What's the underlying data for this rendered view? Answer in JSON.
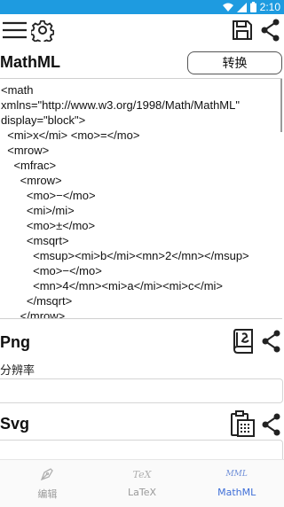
{
  "status_bar": {
    "time": "2:10",
    "icons": [
      "wifi-icon",
      "signal-icon",
      "battery-icon"
    ],
    "background": "#1e9be0"
  },
  "toolbar": {
    "icons": [
      "menu-icon",
      "settings-icon",
      "save-icon",
      "share-icon"
    ]
  },
  "mathml": {
    "title": "MathML",
    "convert_label": "转换",
    "code_lines": [
      "<math",
      "xmlns=\"http://www.w3.org/1998/Math/MathML\"",
      "display=\"block\">",
      "  <mi>x</mi> <mo>=</mo>",
      "  <mrow>",
      "    <mfrac>",
      "      <mrow>",
      "        <mo>−</mo>",
      "        <mi>/mi>",
      "        <mo>±</mo>",
      "        <msqrt>",
      "          <msup><mi>b</mi><mn>2</mn></msup>",
      "          <mo>−</mo>",
      "          <mn>4</mn><mi>a</mi><mi>c</mi>",
      "        </msqrt>",
      "      </mrow>"
    ]
  },
  "png": {
    "title": "Png",
    "resolution_label": "分辨率",
    "resolution_value": ""
  },
  "svg": {
    "title": "Svg"
  },
  "bottom_nav": {
    "items": [
      {
        "label": "编辑",
        "icon": "pen-nib-icon",
        "active": false
      },
      {
        "label": "LaTeX",
        "icon": "tex-icon",
        "glyph": "TeX",
        "active": false
      },
      {
        "label": "MathML",
        "icon": "mml-icon",
        "glyph": "MML",
        "active": true
      }
    ],
    "accent": "#3f6fd8"
  }
}
